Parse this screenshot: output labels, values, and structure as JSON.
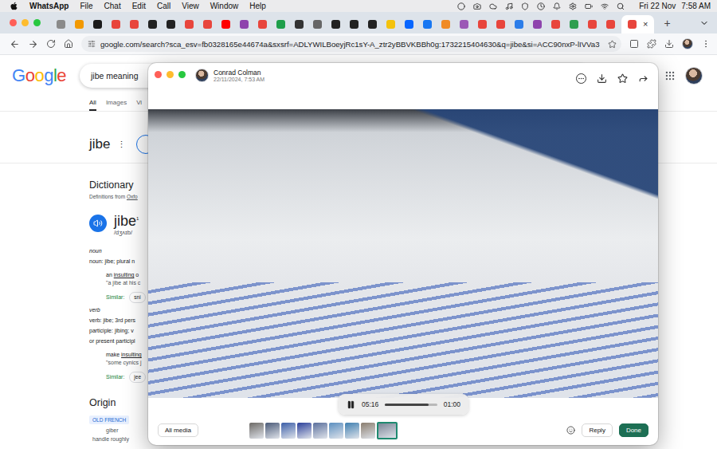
{
  "menubar": {
    "app": "WhatsApp",
    "menus": [
      "File",
      "Chat",
      "Edit",
      "Call",
      "View",
      "Window",
      "Help"
    ],
    "date": "Fri 22 Nov",
    "time": "7:58 AM"
  },
  "browser": {
    "tabs": [
      {
        "color": "#8a8a8a",
        "selected": false
      },
      {
        "color": "#f29900",
        "selected": false
      },
      {
        "color": "#1b1b1b",
        "selected": false
      },
      {
        "color": "#e8453c",
        "selected": false
      },
      {
        "color": "#e8453c",
        "selected": false
      },
      {
        "color": "#222222",
        "selected": false
      },
      {
        "color": "#222222",
        "selected": false
      },
      {
        "color": "#e8453c",
        "selected": false
      },
      {
        "color": "#e8453c",
        "selected": false
      },
      {
        "color": "#ff0000",
        "selected": false
      },
      {
        "color": "#8e44ad",
        "selected": false
      },
      {
        "color": "#e8453c",
        "selected": false
      },
      {
        "color": "#1e9e4a",
        "selected": false
      },
      {
        "color": "#333333",
        "selected": false
      },
      {
        "color": "#666666",
        "selected": false
      },
      {
        "color": "#222222",
        "selected": false
      },
      {
        "color": "#222222",
        "selected": false
      },
      {
        "color": "#222222",
        "selected": false
      },
      {
        "color": "#f4c20d",
        "selected": false
      },
      {
        "color": "#0866ff",
        "selected": false
      },
      {
        "color": "#1877f2",
        "selected": false
      },
      {
        "color": "#f08a24",
        "selected": false
      },
      {
        "color": "#9b59b6",
        "selected": false
      },
      {
        "color": "#e8453c",
        "selected": false
      },
      {
        "color": "#e8453c",
        "selected": false
      },
      {
        "color": "#2b7de9",
        "selected": false
      },
      {
        "color": "#8e44ad",
        "selected": false
      },
      {
        "color": "#e8453c",
        "selected": false
      },
      {
        "color": "#2e9e4f",
        "selected": false
      },
      {
        "color": "#e8453c",
        "selected": false
      },
      {
        "color": "#e8453c",
        "selected": false
      },
      {
        "color": "#e8453c",
        "selected": true
      }
    ],
    "close": "×",
    "new_tab": "+",
    "url": "google.com/search?sca_esv=fb0328165e44674a&sxsrf=ADLYWILBoeyjRc1sY-A_ztr2yBBVKBBh0g:1732215404630&q=jibe&si=ACC90nxP-lIVVa3"
  },
  "google": {
    "logo": "Google",
    "query": "jibe meaning",
    "tabs": [
      {
        "label": "All",
        "selected": true
      },
      {
        "label": "Images",
        "selected": false
      },
      {
        "label": "Vi",
        "selected": false
      }
    ],
    "heading": "jibe",
    "more": "⋮",
    "dictionary": {
      "title": "Dictionary",
      "source_prefix": "Definitions from ",
      "source_link": "Oxfo",
      "word": "jibe",
      "superscript": "1",
      "pronunciation": "/dʒʌɪb/",
      "lines": [
        {
          "kind": "label",
          "text": "noun"
        },
        {
          "kind": "text",
          "text": "noun: jibe; plural n"
        },
        {
          "kind": "definition",
          "before": "an ",
          "link": "insulting",
          "after": " o"
        },
        {
          "kind": "example",
          "text": "\"a jibe at his c"
        },
        {
          "kind": "similar",
          "text": "Similar:",
          "chip": "sni"
        },
        {
          "kind": "label",
          "text": "verb"
        },
        {
          "kind": "text",
          "text": "verb: jibe; 3rd pers"
        },
        {
          "kind": "text",
          "text": "participle: jibing; v"
        },
        {
          "kind": "text",
          "text": "or present participl"
        },
        {
          "kind": "definition",
          "before": "make ",
          "link": "insulting",
          "after": ""
        },
        {
          "kind": "example",
          "text": "\"some cynics j"
        },
        {
          "kind": "similar",
          "text": "Similar:",
          "chip": "jee"
        }
      ]
    },
    "origin": {
      "title": "Origin",
      "chip": "OLD FRENCH",
      "word": "giber",
      "gloss": "handle roughly"
    }
  },
  "viewer": {
    "sender": "Conrad Colman",
    "timestamp": "22/11/2024, 7:53 AM",
    "video": {
      "playing": true,
      "elapsed": "05:16",
      "remaining": "01:00",
      "level": 0.84
    },
    "all_media": "All media",
    "thumbnails": [
      {
        "color": "#6d6a66",
        "selected": false
      },
      {
        "color": "#4a5a78",
        "selected": false
      },
      {
        "color": "#3b5ea8",
        "selected": false
      },
      {
        "color": "#2a3f9a",
        "selected": false
      },
      {
        "color": "#5a6f9c",
        "selected": false
      },
      {
        "color": "#5b8fc0",
        "selected": false
      },
      {
        "color": "#3f7fb0",
        "selected": false
      },
      {
        "color": "#8a7d6e",
        "selected": false
      },
      {
        "color": "#7a8596",
        "selected": true
      }
    ],
    "reply": "Reply",
    "done": "Done"
  }
}
